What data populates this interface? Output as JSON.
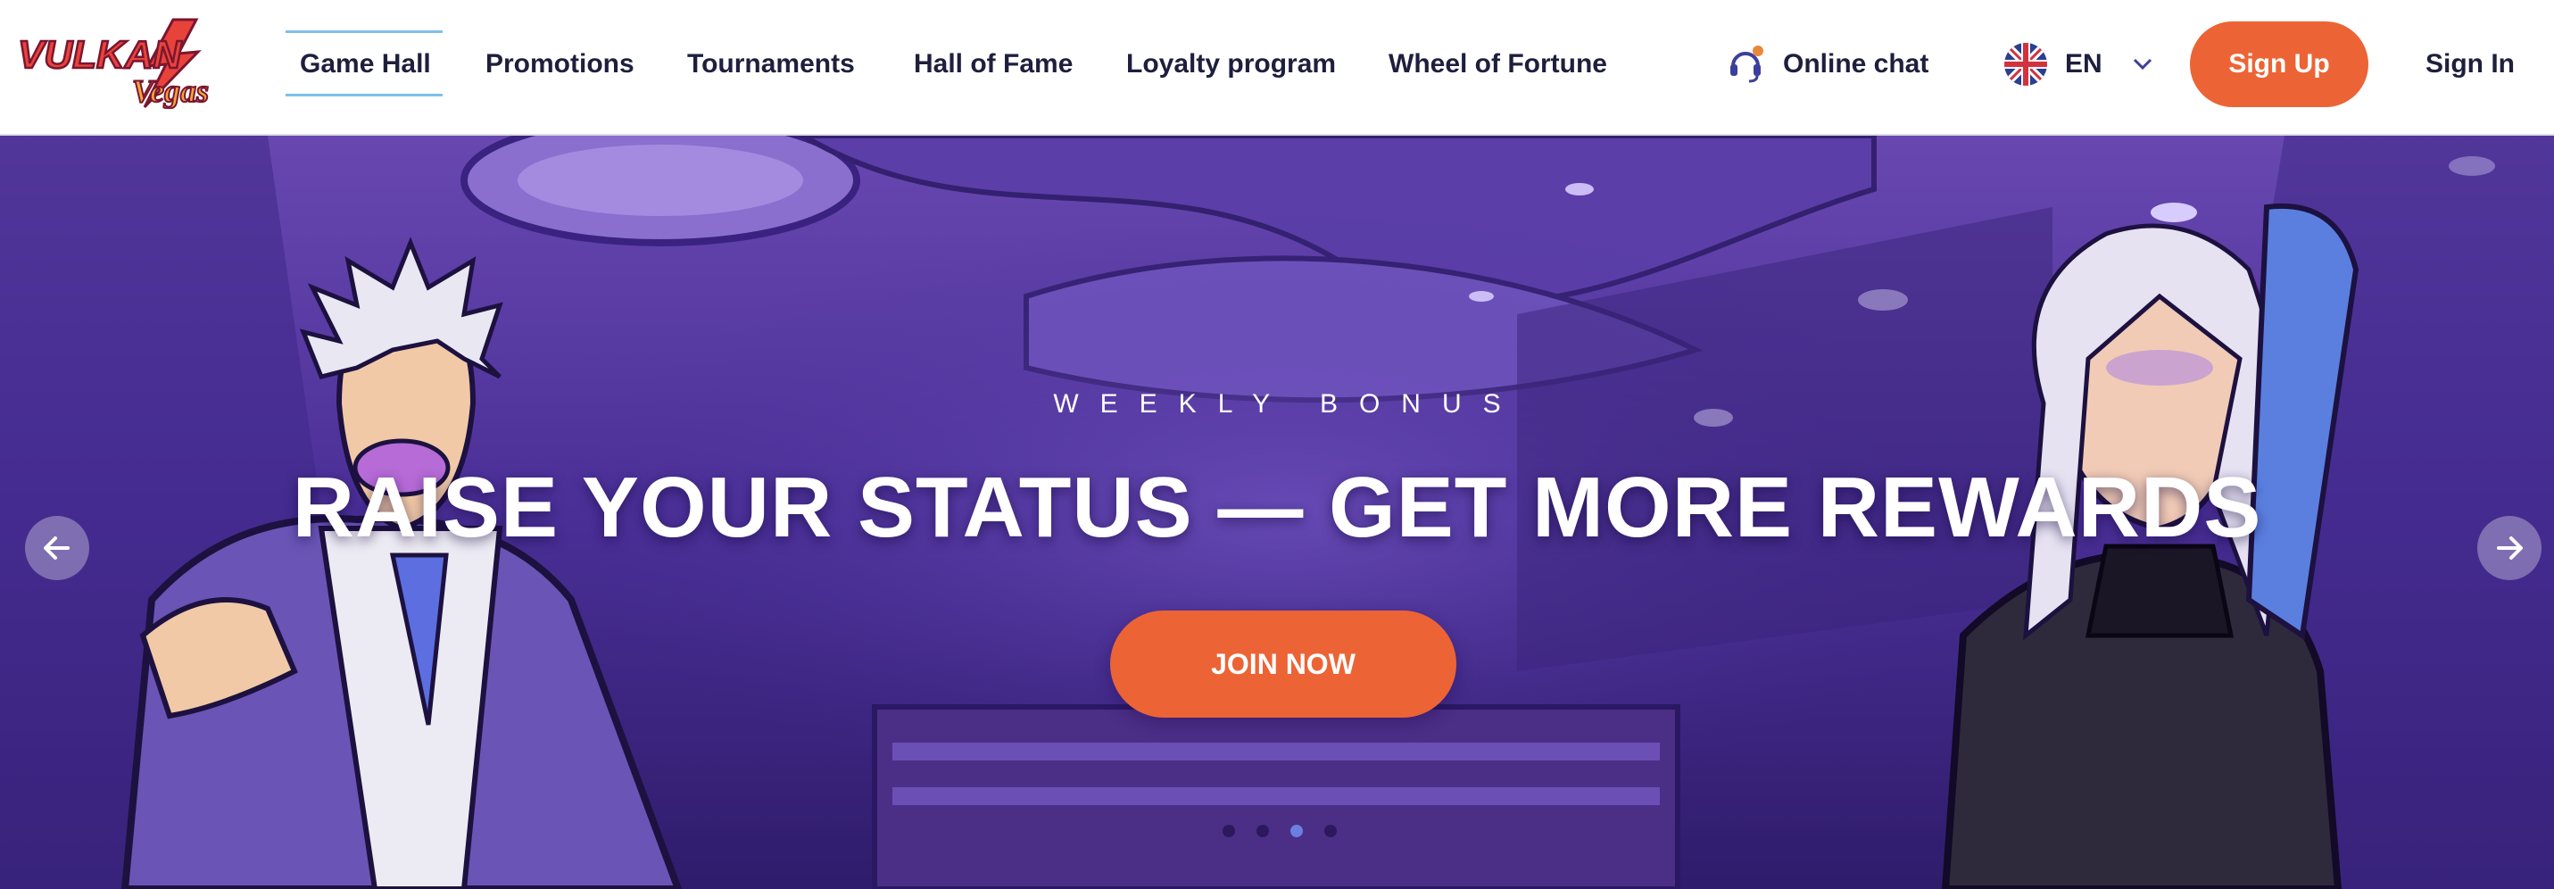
{
  "header": {
    "logo": {
      "text_top": "VULKAN",
      "text_bottom": "Vegas"
    },
    "nav": [
      {
        "label": "Game Hall",
        "active": true
      },
      {
        "label": "Promotions",
        "active": false
      },
      {
        "label": "Tournaments",
        "active": false
      },
      {
        "label": "Hall of Fame",
        "active": false
      },
      {
        "label": "Loyalty program",
        "active": false
      },
      {
        "label": "Wheel of Fortune",
        "active": false
      }
    ],
    "chat": {
      "label": "Online chat",
      "icon": "headset-icon"
    },
    "language": {
      "label": "EN",
      "icon": "uk-flag-icon"
    },
    "signup_label": "Sign Up",
    "signin_label": "Sign In"
  },
  "hero": {
    "eyebrow": "WEEKLY BONUS",
    "headline": "RAISE YOUR STATUS — GET MORE REWARDS",
    "cta_label": "JOIN NOW",
    "slides": {
      "count": 4,
      "active_index": 2
    }
  },
  "colors": {
    "accent": "#ec6435",
    "nav_text": "#1d1f3d",
    "active_tab_line": "#7ec0ea",
    "hero_bg": "#4a2f97"
  }
}
